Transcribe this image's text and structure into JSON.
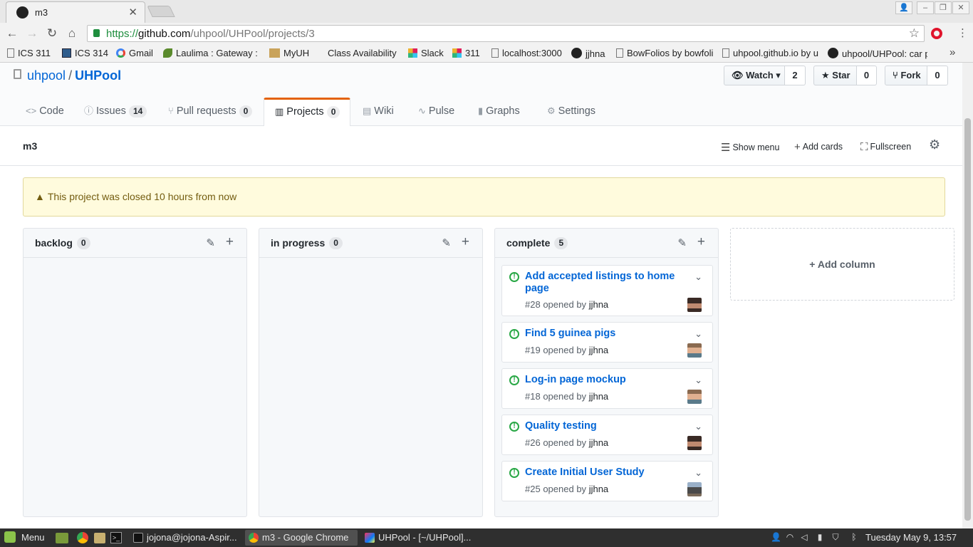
{
  "browser": {
    "tab_title": "m3",
    "url_scheme": "https://",
    "url_host": "github.com",
    "url_path": "/uhpool/UHPool/projects/3",
    "bookmarks": [
      {
        "label": "ICS 311",
        "icon": "page-icon"
      },
      {
        "label": "ICS 314",
        "icon": "square-icon"
      },
      {
        "label": "Gmail",
        "icon": "google-icon"
      },
      {
        "label": "Laulima : Gateway : W",
        "icon": "laulima-icon"
      },
      {
        "label": "MyUH",
        "icon": "uh-icon"
      },
      {
        "label": "Class Availability",
        "icon": "blank-icon"
      },
      {
        "label": "Slack",
        "icon": "slack-icon"
      },
      {
        "label": "311",
        "icon": "slack-icon"
      },
      {
        "label": "localhost:3000",
        "icon": "page-icon"
      },
      {
        "label": "jjhna",
        "icon": "github-icon"
      },
      {
        "label": "BowFolios by bowfoli",
        "icon": "page-icon"
      },
      {
        "label": "uhpool.github.io by u",
        "icon": "page-icon"
      },
      {
        "label": "uhpool/UHPool: car p",
        "icon": "github-icon"
      }
    ]
  },
  "repo": {
    "owner": "uhpool",
    "separator": "/",
    "name": "UHPool",
    "watch_label": "Watch",
    "watch_count": "2",
    "star_label": "Star",
    "star_count": "0",
    "fork_label": "Fork",
    "fork_count": "0"
  },
  "nav": {
    "code": "Code",
    "issues": "Issues",
    "issues_count": "14",
    "pulls": "Pull requests",
    "pulls_count": "0",
    "projects": "Projects",
    "projects_count": "0",
    "wiki": "Wiki",
    "pulse": "Pulse",
    "graphs": "Graphs",
    "settings": "Settings"
  },
  "project": {
    "name": "m3",
    "show_menu": "Show menu",
    "add_cards": "Add cards",
    "fullscreen": "Fullscreen",
    "notice": "This project was closed 10 hours from now",
    "add_column": "Add column",
    "columns": [
      {
        "title": "backlog",
        "count": "0",
        "cards": []
      },
      {
        "title": "in progress",
        "count": "0",
        "cards": []
      },
      {
        "title": "complete",
        "count": "5",
        "cards": [
          {
            "title": "Add accepted listings to home page",
            "number": "#28",
            "opened_by": "opened by",
            "user": "jjhna"
          },
          {
            "title": "Find 5 guinea pigs",
            "number": "#19",
            "opened_by": "opened by",
            "user": "jjhna"
          },
          {
            "title": "Log-in page mockup",
            "number": "#18",
            "opened_by": "opened by",
            "user": "jjhna"
          },
          {
            "title": "Quality testing",
            "number": "#26",
            "opened_by": "opened by",
            "user": "jjhna"
          },
          {
            "title": "Create Initial User Study",
            "number": "#25",
            "opened_by": "opened by",
            "user": "jjhna"
          }
        ]
      }
    ]
  },
  "taskbar": {
    "menu": "Menu",
    "windows": [
      {
        "label": "jojona@jojona-Aspir...",
        "icon": "terminal-icon"
      },
      {
        "label": "m3 - Google Chrome",
        "icon": "chrome-icon"
      },
      {
        "label": "UHPool - [~/UHPool]...",
        "icon": "intellij-icon"
      }
    ],
    "clock": "Tuesday May  9, 13:57"
  },
  "colors": {
    "link": "#0366d6",
    "open_issue": "#28a745",
    "selected_tab_accent": "#e36209",
    "flash_bg": "#fffbdd"
  }
}
